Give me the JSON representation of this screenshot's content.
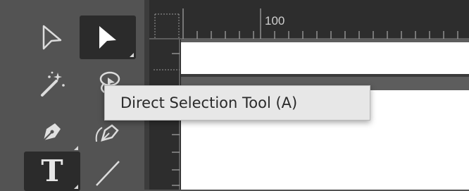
{
  "ruler": {
    "label_100": "100"
  },
  "tooltip": {
    "text": "Direct Selection Tool (A)"
  },
  "tools": [
    {
      "name": "selection-tool",
      "icon": "arrow-outline-icon"
    },
    {
      "name": "direct-selection-tool",
      "icon": "arrow-filled-icon",
      "active": true
    },
    {
      "name": "magic-wand-tool",
      "icon": "magic-wand-icon"
    },
    {
      "name": "lasso-tool",
      "icon": "lasso-icon"
    },
    {
      "name": "pen-tool",
      "icon": "pen-icon"
    },
    {
      "name": "curvature-pen-tool",
      "icon": "curvature-pen-icon"
    },
    {
      "name": "type-tool",
      "icon": "type-icon",
      "glyph": "T",
      "active": true
    },
    {
      "name": "line-tool",
      "icon": "line-icon"
    }
  ],
  "colors": {
    "toolbar_bg": "#535353",
    "active_tool_bg": "#2b2b2b",
    "ruler_bg": "#2d2d2d",
    "tooltip_bg": "#e7e7e7",
    "canvas_white": "#ffffff"
  }
}
